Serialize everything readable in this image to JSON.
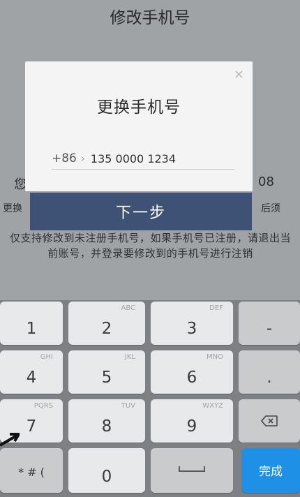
{
  "page": {
    "title": "修改手机号",
    "bg_left_char": "您",
    "bg_right_digits": "08",
    "bg_left_small": "更换",
    "bg_right_small": "后须",
    "notice": "仅支持修改到未注册手机号，如果手机号已注册，请退出当前账号，并登录要修改到的手机号进行注销"
  },
  "dialog": {
    "title": "更换手机号",
    "close_glyph": "×",
    "country_code": "+86",
    "chevron_glyph": "›",
    "phone_value": "135 0000 1234",
    "next_label": "下一步"
  },
  "keypad": {
    "keys": [
      {
        "id": "1",
        "num": "1",
        "sub": ""
      },
      {
        "id": "2",
        "num": "2",
        "sub": "ABC"
      },
      {
        "id": "3",
        "num": "3",
        "sub": "DEF"
      },
      {
        "id": "dash",
        "num": "-",
        "sub": ""
      },
      {
        "id": "4",
        "num": "4",
        "sub": "GHI"
      },
      {
        "id": "5",
        "num": "5",
        "sub": "JKL"
      },
      {
        "id": "6",
        "num": "6",
        "sub": "MNO"
      },
      {
        "id": "dot",
        "num": ".",
        "sub": ""
      },
      {
        "id": "7",
        "num": "7",
        "sub": "PQRS"
      },
      {
        "id": "8",
        "num": "8",
        "sub": "TUV"
      },
      {
        "id": "9",
        "num": "9",
        "sub": "WXYZ"
      },
      {
        "id": "symbols",
        "num": "* # (",
        "sub": ""
      },
      {
        "id": "0",
        "num": "0",
        "sub": ""
      },
      {
        "id": "done",
        "num": "完成",
        "sub": ""
      }
    ],
    "accent_color": "#1e90e6"
  }
}
